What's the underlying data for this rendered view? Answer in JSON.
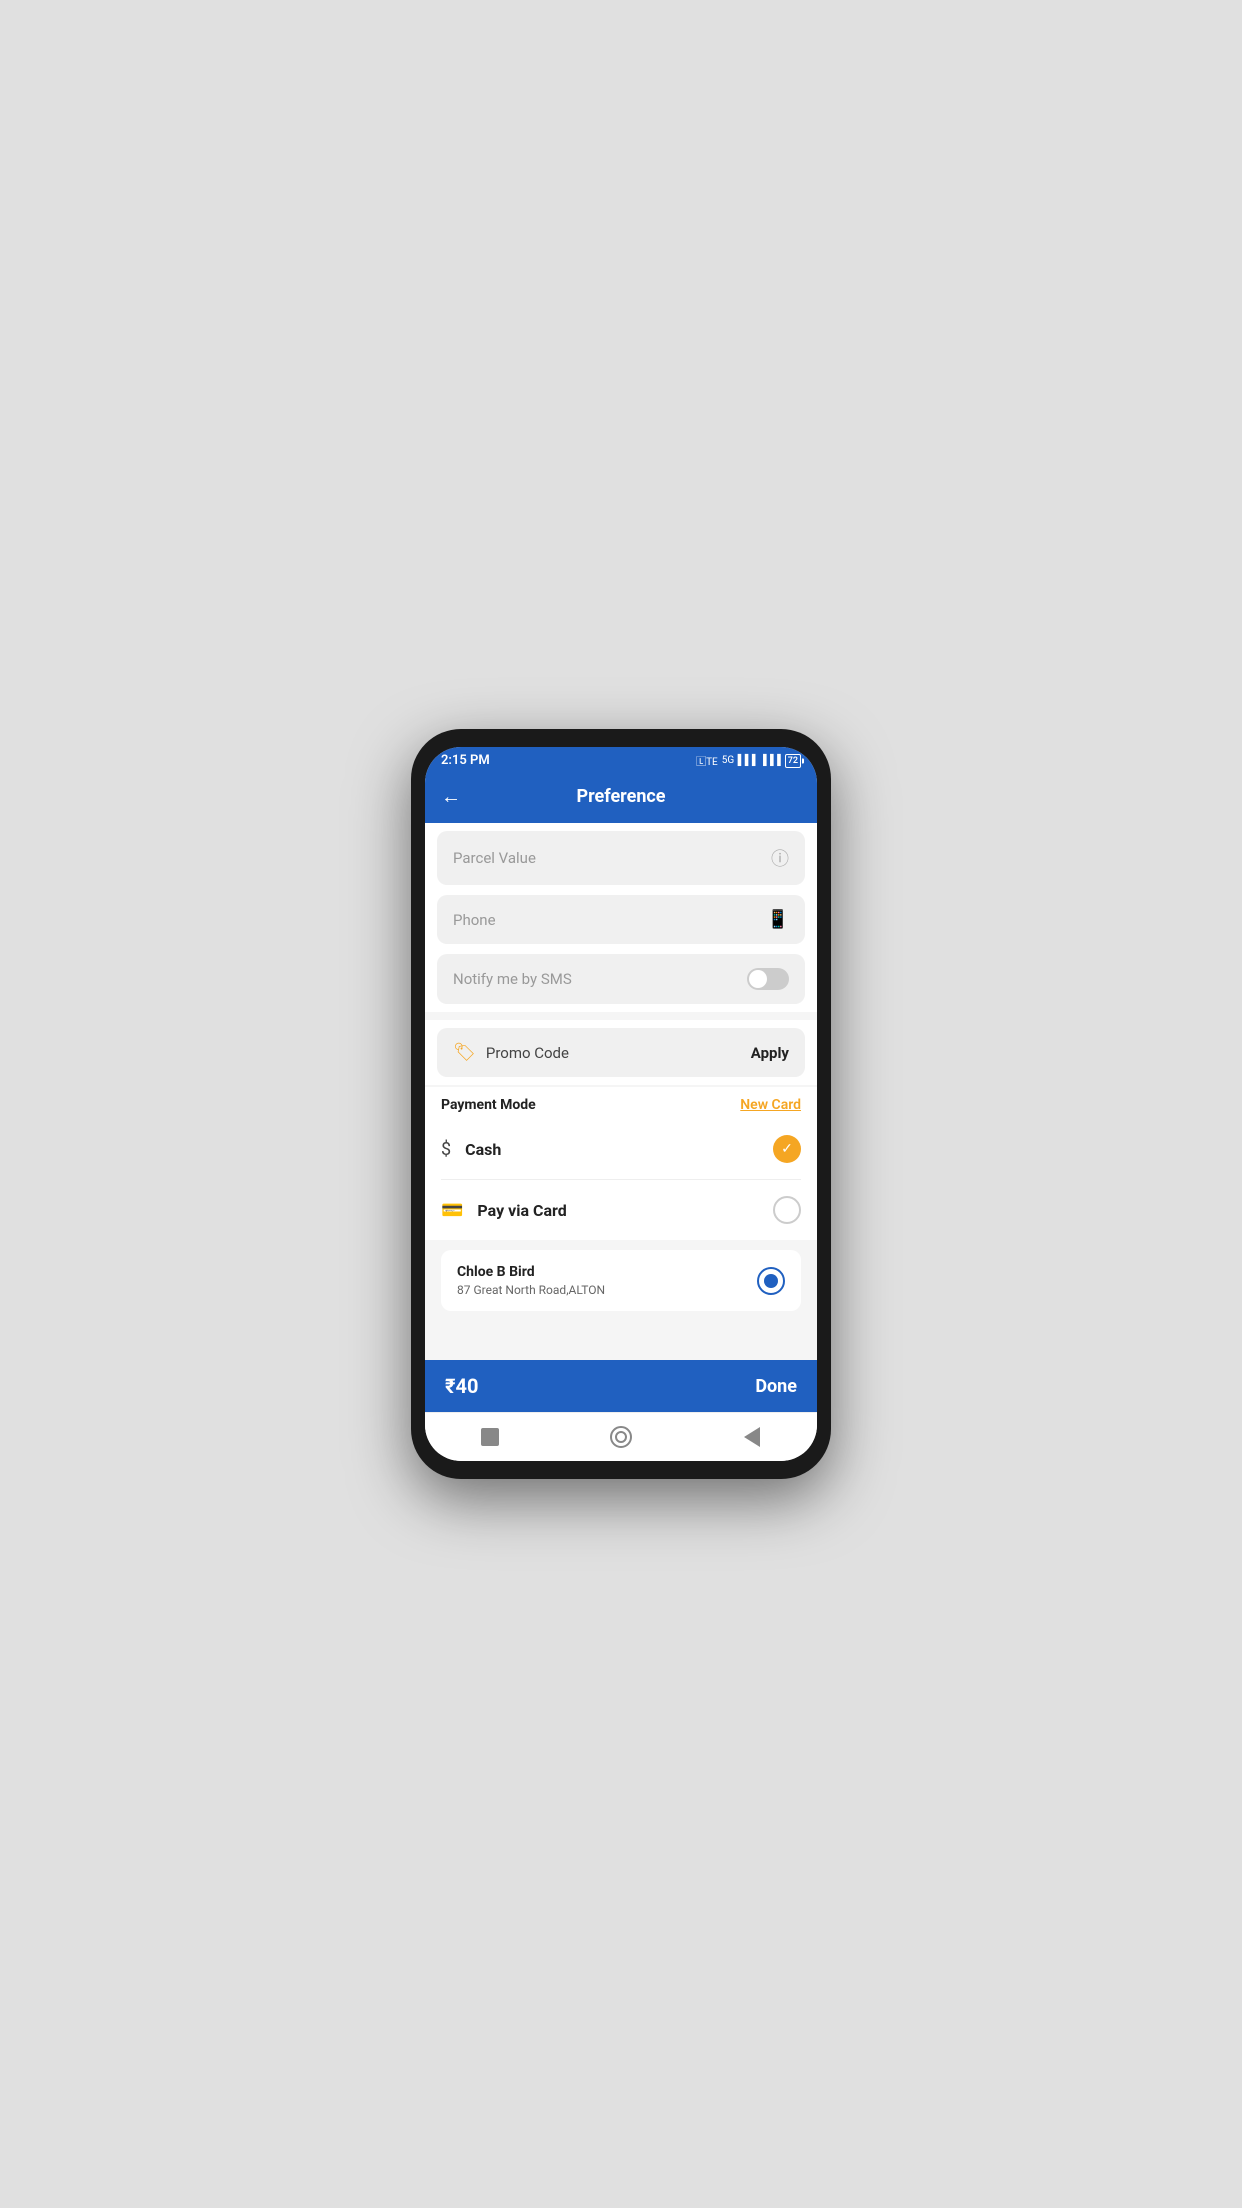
{
  "status_bar": {
    "time": "2:15 PM",
    "battery": "72"
  },
  "header": {
    "back_label": "←",
    "title": "Preference"
  },
  "fields": {
    "parcel_value_placeholder": "Parcel Value",
    "phone_placeholder": "Phone",
    "sms_label": "Notify me by SMS"
  },
  "promo": {
    "label": "Promo Code",
    "apply_label": "Apply"
  },
  "payment": {
    "mode_label": "Payment Mode",
    "new_card_label": "New Card",
    "options": [
      {
        "id": "cash",
        "label": "Cash",
        "icon": "$",
        "selected": true
      },
      {
        "id": "card",
        "label": "Pay via Card",
        "icon": "▬",
        "selected": false
      }
    ]
  },
  "address": {
    "name": "Chloe B Bird",
    "street": "87  Great North Road,ALTON"
  },
  "footer": {
    "price": "₹40",
    "done_label": "Done"
  }
}
